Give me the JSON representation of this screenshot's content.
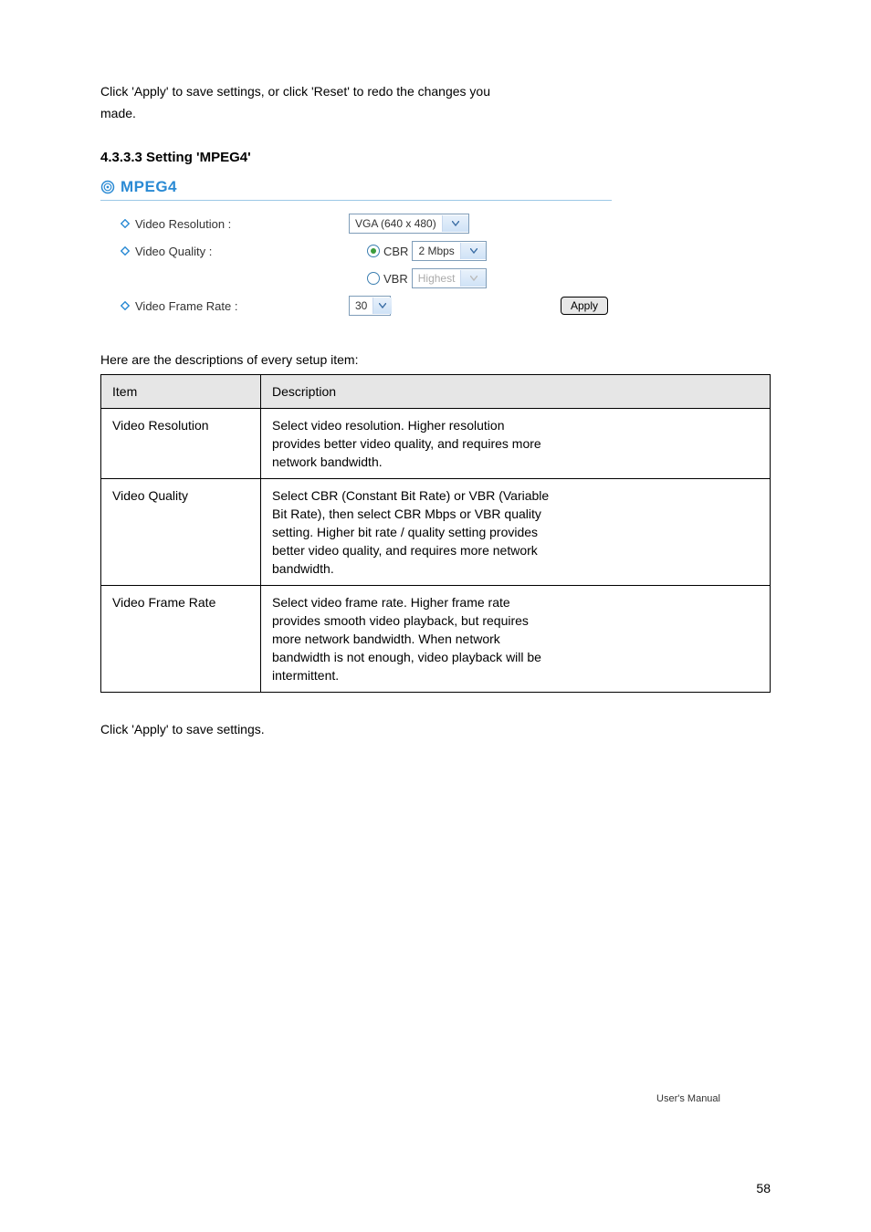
{
  "intro": {
    "l1": "Click 'Apply' to save settings, or click 'Reset' to redo the changes you",
    "l2": "made."
  },
  "section_title": "4.3.3.3 Setting 'MPEG4'",
  "panel": {
    "heading": "MPEG4",
    "rows": {
      "res_label": "Video Resolution :",
      "res_value": "VGA (640 x 480)",
      "qual_label": "Video Quality :",
      "cbr_label": "CBR",
      "cbr_value": "2 Mbps",
      "vbr_label": "VBR",
      "vbr_value": "Highest",
      "fps_label": "Video Frame Rate :",
      "fps_value": "30",
      "apply": "Apply"
    }
  },
  "desc_lead": "Here are the descriptions of every setup item:",
  "table": {
    "h_item": "Item",
    "h_desc": "Description",
    "r1_item": "Video Resolution",
    "r1_desc_l1": "Select video resolution. Higher resolution",
    "r1_desc_l2": "provides better video quality, and requires more",
    "r1_desc_l3": "network bandwidth.",
    "r2_item": "Video Quality",
    "r2_desc_l1": "Select CBR (Constant Bit Rate) or VBR (Variable",
    "r2_desc_l2": "Bit Rate), then select CBR Mbps or VBR quality",
    "r2_desc_l3": "setting. Higher bit rate / quality setting provides",
    "r2_desc_l4": "better video quality, and requires more network",
    "r2_desc_l5": "bandwidth.",
    "r3_item": "Video Frame Rate",
    "r3_desc_l1": "Select video frame rate. Higher frame rate",
    "r3_desc_l2": "provides smooth video playback, but requires",
    "r3_desc_l3": "more network bandwidth. When network",
    "r3_desc_l4": "bandwidth is not enough, video playback will be",
    "r3_desc_l5": "intermittent."
  },
  "outro": "Click 'Apply' to save settings.",
  "footer": {
    "manual": "User's Manual",
    "page": "58"
  }
}
